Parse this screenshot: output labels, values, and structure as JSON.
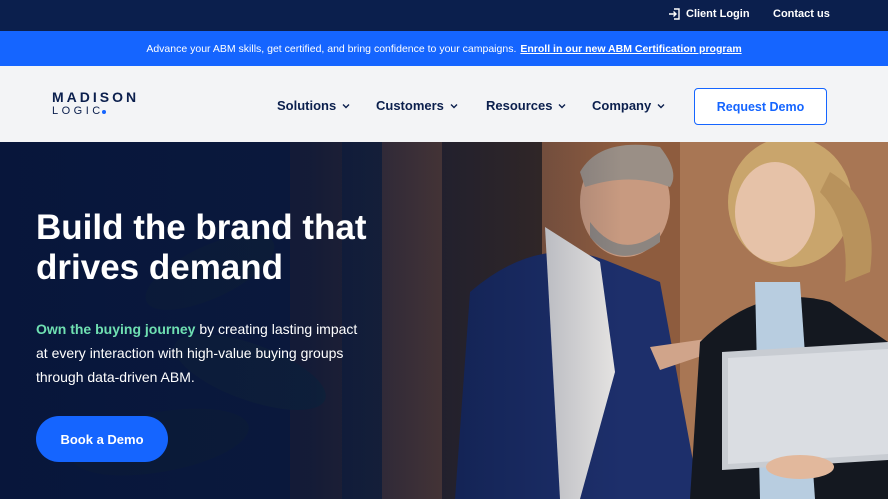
{
  "utility": {
    "client_login": "Client Login",
    "contact_us": "Contact us"
  },
  "announcement": {
    "text": "Advance your ABM skills, get certified, and bring confidence to your campaigns.",
    "link": "Enroll in our new ABM Certification program"
  },
  "logo": {
    "top": "MADISON",
    "bottom": "LOGIC"
  },
  "nav": {
    "items": [
      {
        "label": "Solutions"
      },
      {
        "label": "Customers"
      },
      {
        "label": "Resources"
      },
      {
        "label": "Company"
      }
    ],
    "cta": "Request Demo"
  },
  "hero": {
    "title": "Build the brand that drives demand",
    "highlight": "Own the buying journey",
    "subtitle": " by creating lasting impact at every interaction with high-value buying groups through data-driven ABM.",
    "button": "Book a Demo"
  },
  "colors": {
    "navy": "#0b1f4d",
    "brand_blue": "#1565ff",
    "highlight_green": "#6fe0b2"
  }
}
